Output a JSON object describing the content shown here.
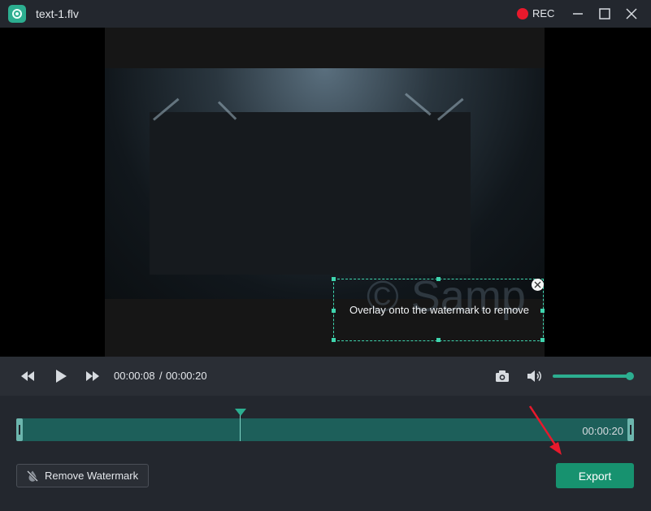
{
  "window": {
    "title": "text-1.flv",
    "rec_label": "REC"
  },
  "overlay": {
    "instruction": "Overlay onto the watermark to remove"
  },
  "video": {
    "watermark_text": "© Samp"
  },
  "player": {
    "current_time": "00:00:08",
    "separator": "/",
    "total_time": "00:00:20",
    "volume_percent": 100
  },
  "timeline": {
    "end_time": "00:00:20",
    "playhead_fraction": 0.4
  },
  "buttons": {
    "remove_watermark": "Remove Watermark",
    "export": "Export"
  },
  "colors": {
    "accent": "#2cae90",
    "export_bg": "#17926f",
    "rec": "#e8192c",
    "annotation_arrow": "#e8192c"
  },
  "icons": {
    "app": "app-logo-icon",
    "rewind": "rewind-icon",
    "play": "play-icon",
    "fast_forward": "fast-forward-icon",
    "snapshot": "camera-icon",
    "volume": "volume-icon",
    "remove_watermark": "watermark-off-icon"
  }
}
